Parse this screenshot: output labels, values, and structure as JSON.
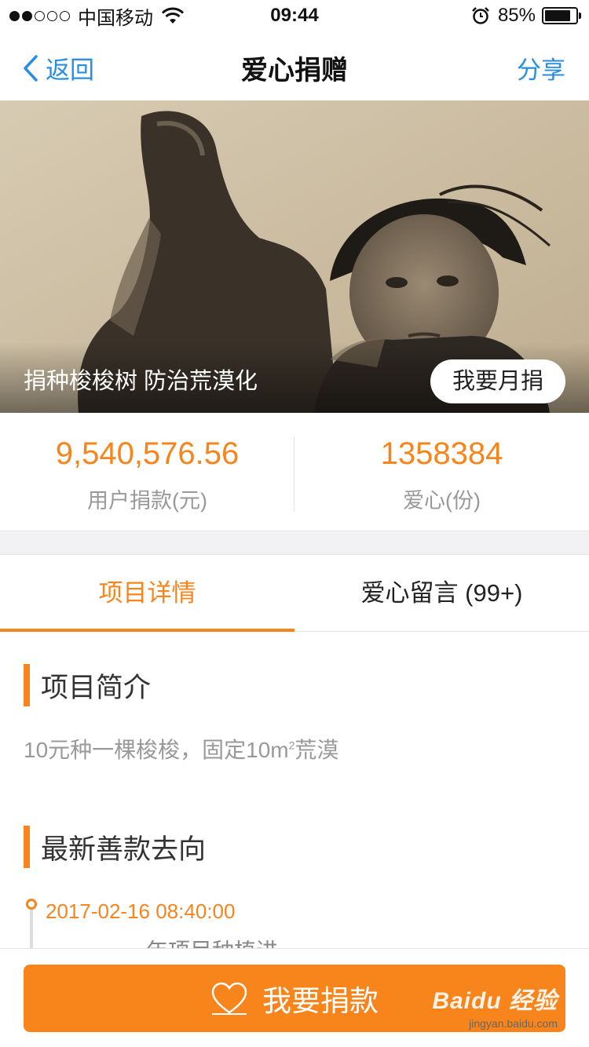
{
  "status_bar": {
    "carrier": "中国移动",
    "time": "09:44",
    "battery_percent": "85%",
    "battery_level": 0.85,
    "signal_bars_filled": 2,
    "signal_bars_total": 5
  },
  "nav": {
    "back_label": "返回",
    "title": "爱心捐赠",
    "share_label": "分享"
  },
  "hero": {
    "caption": "捐种梭梭树 防治荒漠化",
    "monthly_button": "我要月捐"
  },
  "stats": [
    {
      "value": "9,540,576.56",
      "label": "用户捐款(元)"
    },
    {
      "value": "1358384",
      "label": "爱心(份)"
    }
  ],
  "tabs": [
    {
      "label": "项目详情",
      "active": true
    },
    {
      "label": "爱心留言 (99+)",
      "active": false
    }
  ],
  "intro": {
    "title": "项目简介",
    "text_before": "10元种一棵梭梭，固定10m",
    "superscript": "2",
    "text_after": "荒漠"
  },
  "latest": {
    "title": "最新善款去向",
    "entries": [
      {
        "date": "2017-02-16 08:40:00",
        "text": "……年项目种植进行中"
      }
    ]
  },
  "donate_button": "我要捐款",
  "watermark": {
    "logo": "Baidu 经验",
    "sub": "jingyan.baidu.com"
  },
  "colors": {
    "accent": "#f7851c",
    "link": "#2a8ee0"
  },
  "icons": {
    "back": "chevron-left-icon",
    "heart": "heart-outline-icon",
    "wifi": "wifi-icon",
    "alarm": "alarm-icon"
  }
}
